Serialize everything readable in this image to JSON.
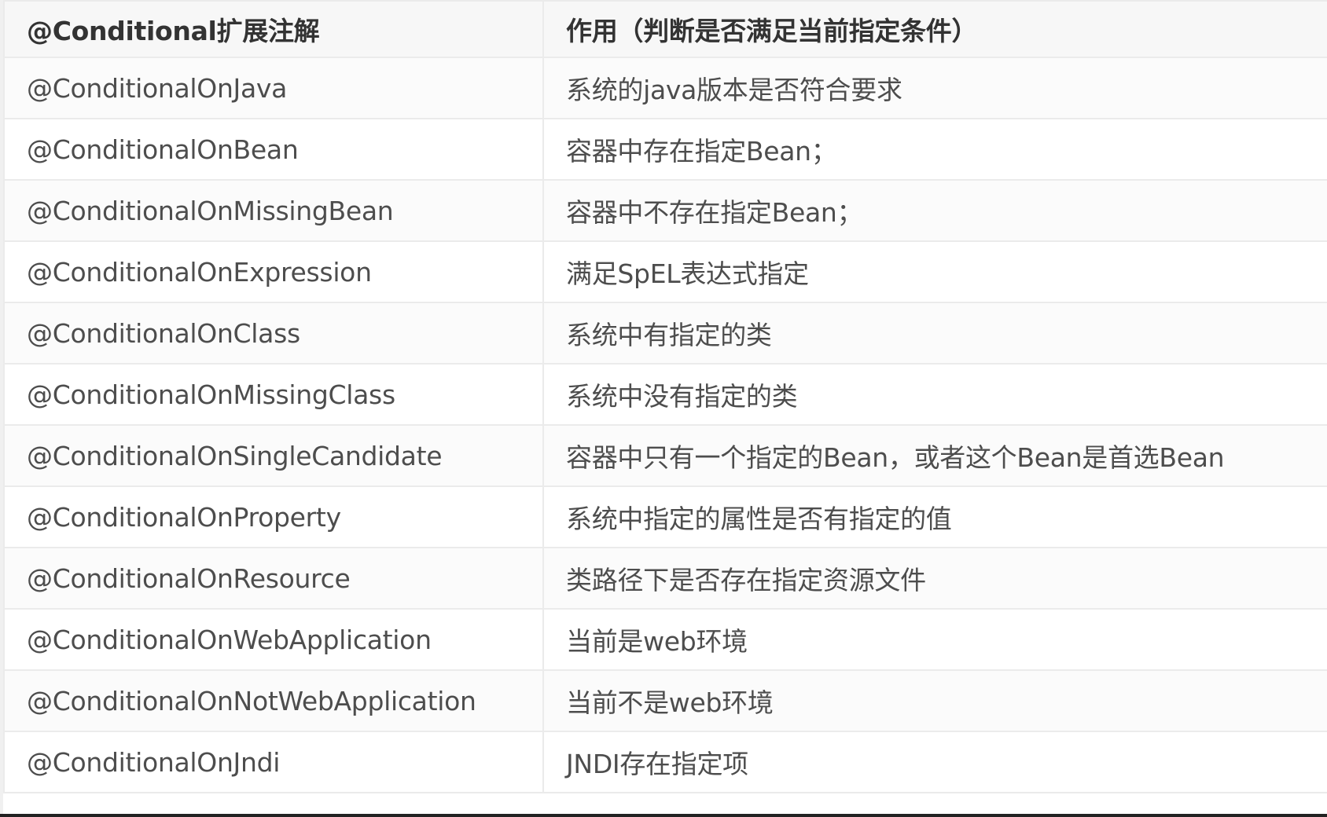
{
  "table": {
    "headers": [
      "@Conditional扩展注解",
      "作用（判断是否满足当前指定条件）"
    ],
    "rows": [
      [
        "@ConditionalOnJava",
        "系统的java版本是否符合要求"
      ],
      [
        "@ConditionalOnBean",
        "容器中存在指定Bean；"
      ],
      [
        "@ConditionalOnMissingBean",
        "容器中不存在指定Bean；"
      ],
      [
        "@ConditionalOnExpression",
        "满足SpEL表达式指定"
      ],
      [
        "@ConditionalOnClass",
        "系统中有指定的类"
      ],
      [
        "@ConditionalOnMissingClass",
        "系统中没有指定的类"
      ],
      [
        "@ConditionalOnSingleCandidate",
        "容器中只有一个指定的Bean，或者这个Bean是首选Bean"
      ],
      [
        "@ConditionalOnProperty",
        "系统中指定的属性是否有指定的值"
      ],
      [
        "@ConditionalOnResource",
        "类路径下是否存在指定资源文件"
      ],
      [
        "@ConditionalOnWebApplication",
        "当前是web环境"
      ],
      [
        "@ConditionalOnNotWebApplication",
        "当前不是web环境"
      ],
      [
        "@ConditionalOnJndi",
        "JNDI存在指定项"
      ]
    ]
  }
}
